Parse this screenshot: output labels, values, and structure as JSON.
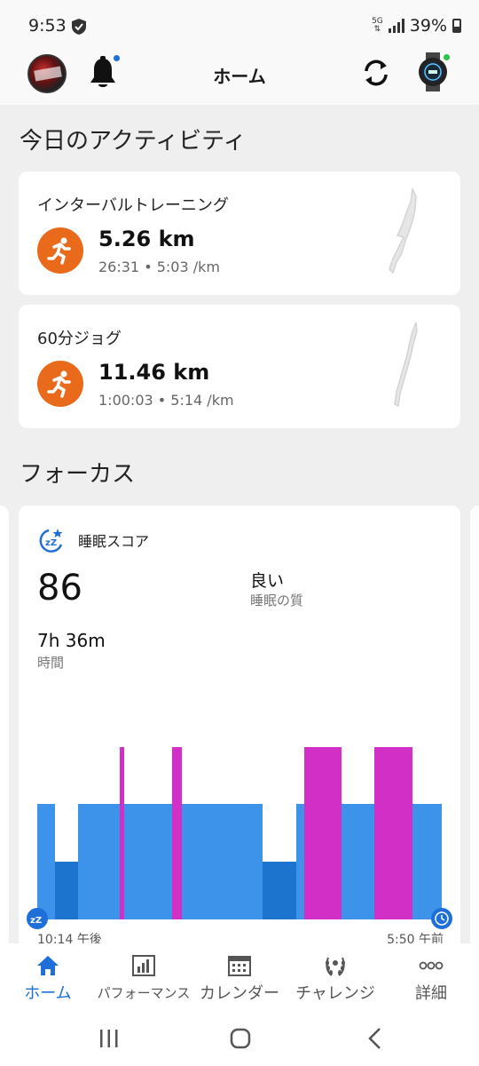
{
  "status_bar": {
    "time": "9:53",
    "network": "5G",
    "battery": "39%"
  },
  "header": {
    "title": "ホーム"
  },
  "activities_section": {
    "title": "今日のアクティビティ"
  },
  "activities": [
    {
      "name": "インターバルトレーニング",
      "distance": "5.26 km",
      "details": "26:31 • 5:03 /km"
    },
    {
      "name": "60分ジョグ",
      "distance": "11.46 km",
      "details": "1:00:03 • 5:14 /km"
    }
  ],
  "focus_section": {
    "title": "フォーカス"
  },
  "sleep": {
    "title": "睡眠スコア",
    "score": "86",
    "quality": "良い",
    "quality_label": "睡眠の質",
    "duration": "7h 36m",
    "duration_label": "時間",
    "start_time": "10:14 午後",
    "end_time": "5:50 午前",
    "colors": {
      "light": "#3d93ea",
      "deep": "#1c74cf",
      "rem": "#d12fc5",
      "awake": "#d12fc5"
    }
  },
  "bottom_nav": [
    {
      "label": "ホーム",
      "icon": "home-icon",
      "active": true
    },
    {
      "label": "パフォーマンス",
      "icon": "bar-chart-icon",
      "active": false
    },
    {
      "label": "カレンダー",
      "icon": "calendar-icon",
      "active": false
    },
    {
      "label": "チャレンジ",
      "icon": "laurel-icon",
      "active": false
    },
    {
      "label": "詳細",
      "icon": "more-icon",
      "active": false
    }
  ],
  "colors": {
    "accent": "#1e6fd9",
    "activity_orange": "#ea6a1c"
  }
}
